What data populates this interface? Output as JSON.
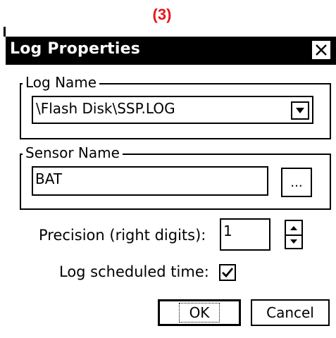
{
  "caption": "(3)",
  "dialog": {
    "title": "Log Properties",
    "close_icon": "close-icon"
  },
  "log_name": {
    "group_label": "Log Name",
    "selected_value": "\\Flash Disk\\SSP.LOG",
    "dropdown_icon": "chevron-down-icon"
  },
  "sensor_name": {
    "group_label": "Sensor Name",
    "value": "BAT",
    "browse_label": "..."
  },
  "precision": {
    "label": "Precision (right digits):",
    "value": "1",
    "spinner_icon": "up-down-arrows-icon"
  },
  "log_scheduled": {
    "label": "Log scheduled time:",
    "checked": true
  },
  "buttons": {
    "ok_label": "OK",
    "cancel_label": "Cancel"
  },
  "colors": {
    "caption": "#e8141b",
    "titlebar_bg": "#000000",
    "titlebar_text": "#ffffff"
  }
}
